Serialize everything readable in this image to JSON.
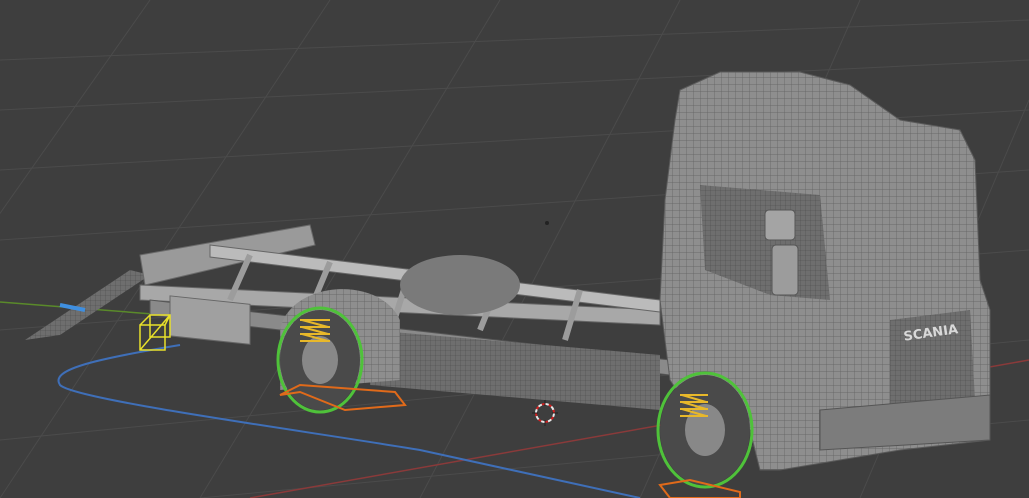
{
  "viewport": {
    "logo_text": "SCANIA"
  },
  "colors": {
    "background": "#3e3e3e",
    "grid": "#4a4a4a",
    "x_axis": "#8a3a3a",
    "y_axis": "#5a8a2a",
    "curve": "#3f6fb8",
    "mesh": "#8c8c8c",
    "mesh_light": "#b0b0b0",
    "selection_green": "#4fc23a",
    "spring_yellow": "#e8b82a",
    "empty_orange": "#e06a1a"
  }
}
